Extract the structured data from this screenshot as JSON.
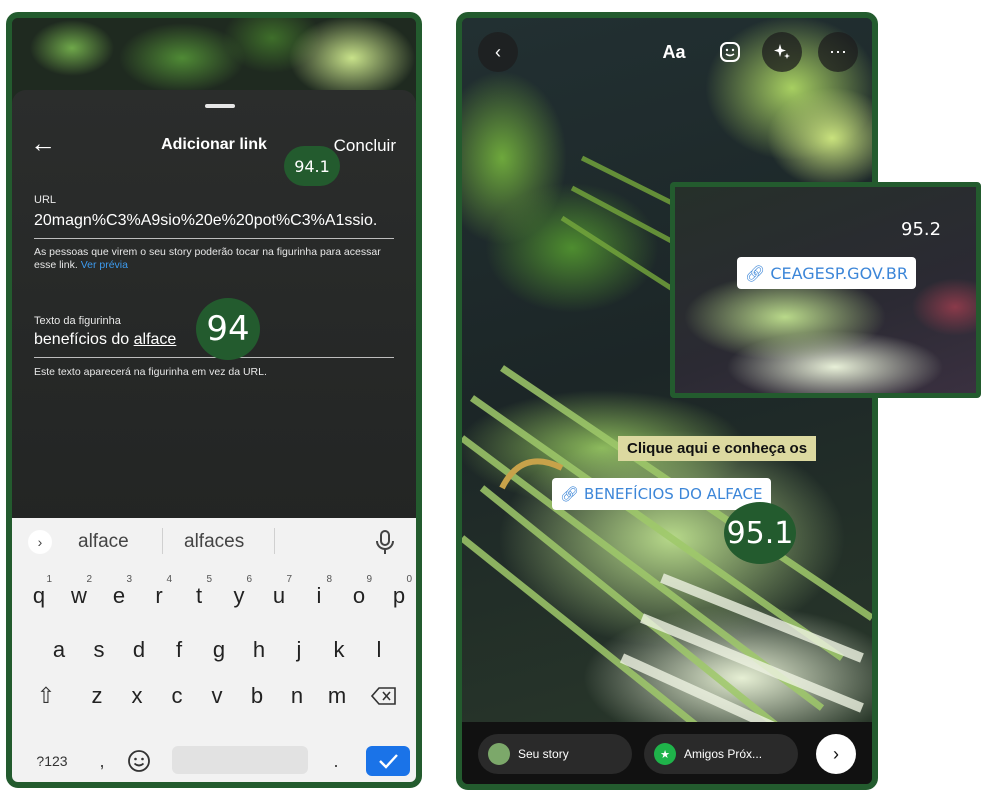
{
  "left": {
    "sheet_title": "Adicionar link",
    "conclude_label": "Concluir",
    "url_label": "URL",
    "url_value": "20magn%C3%A9sio%20e%20pot%C3%A1ssio.",
    "help_text": "As pessoas que virem o seu story poderão tocar na figurinha para acessar esse link.",
    "preview_link": "Ver prévia",
    "sticker_text_label": "Texto da figurinha",
    "sticker_text_prefix": "benefícios do ",
    "sticker_text_word": "alface",
    "sticker_help": "Este texto aparecerá na figurinha em vez da URL.",
    "badge_conclude": "94.1",
    "badge_field": "94"
  },
  "keyboard": {
    "suggestions": [
      "alface",
      "alfaces"
    ],
    "row1": [
      {
        "k": "q",
        "n": "1"
      },
      {
        "k": "w",
        "n": "2"
      },
      {
        "k": "e",
        "n": "3"
      },
      {
        "k": "r",
        "n": "4"
      },
      {
        "k": "t",
        "n": "5"
      },
      {
        "k": "y",
        "n": "6"
      },
      {
        "k": "u",
        "n": "7"
      },
      {
        "k": "i",
        "n": "8"
      },
      {
        "k": "o",
        "n": "9"
      },
      {
        "k": "p",
        "n": "0"
      }
    ],
    "row2": [
      "a",
      "s",
      "d",
      "f",
      "g",
      "h",
      "j",
      "k",
      "l"
    ],
    "row3": [
      "z",
      "x",
      "c",
      "v",
      "b",
      "n",
      "m"
    ],
    "symbols_label": "?123",
    "comma_label": ",",
    "period_label": "."
  },
  "right": {
    "text_tool_label": "Aa",
    "caption_text": "Clique aqui e conheça os",
    "link_sticker_text": "BENEFÍCIOS DO ALFACE",
    "badge_sticker": "95.1",
    "share_story_label": "Seu story",
    "share_close_friends_label": "Amigos Próx..."
  },
  "inset": {
    "sticker_text": "CEAGESP.GOV.BR",
    "badge": "95.2"
  },
  "colors": {
    "frame_green": "#235b2e",
    "link_blue": "#3c86d8",
    "enter_blue": "#1a73e8",
    "caption_bg": "#dcd9a0",
    "close_friends_green": "#1fb34a"
  },
  "icons": [
    "back-arrow-icon",
    "chevron-right-icon",
    "mic-icon",
    "shift-icon",
    "backspace-icon",
    "emoji-icon",
    "check-icon",
    "chevron-left-icon",
    "sticker-icon",
    "sparkles-icon",
    "more-icon",
    "link-icon",
    "star-icon"
  ]
}
